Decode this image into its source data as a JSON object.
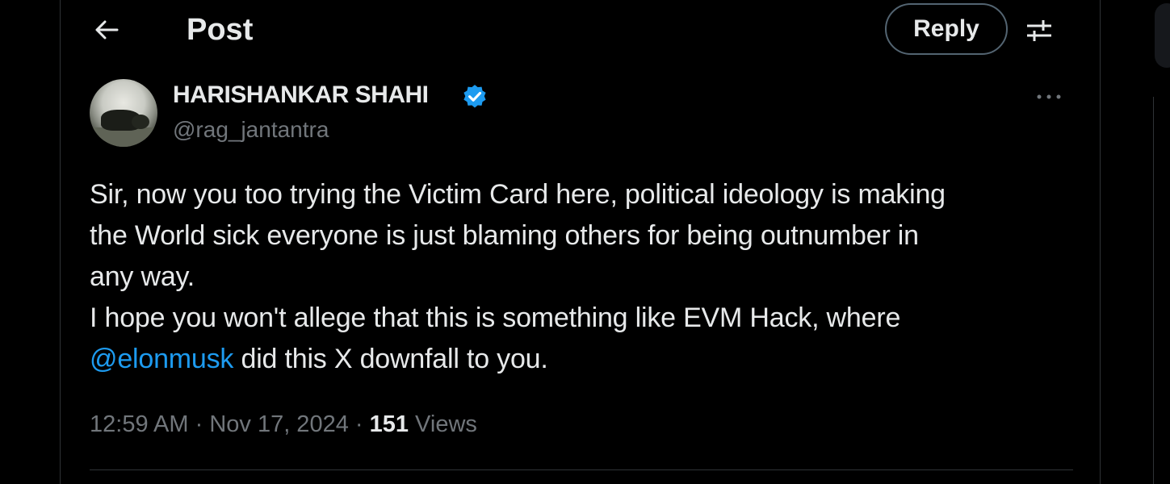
{
  "header": {
    "title": "Post",
    "reply_label": "Reply",
    "back_icon": "arrow-left-icon",
    "filter_icon": "sliders-icon"
  },
  "post": {
    "author_name": "HARISHANKAR SHAHI",
    "handle": "@rag_jantantra",
    "verified": true,
    "body_lines": [
      "Sir, now you too trying the Victim Card here, political ideology is making",
      "the World sick everyone is just blaming others for being outnumber in",
      "any way.",
      "I hope you won't allege that this is something like EVM Hack, where"
    ],
    "mention": "@elonmusk",
    "body_tail": " did this X downfall to you.",
    "time": "12:59 AM",
    "date": "Nov 17, 2024",
    "separator": " · ",
    "views_count": "151",
    "views_label": " Views"
  },
  "colors": {
    "background": "#000000",
    "text_primary": "#e7e9ea",
    "text_secondary": "#71767b",
    "link": "#1d9bf0",
    "verified_badge": "#1d9bf0",
    "border": "#2f3336"
  }
}
